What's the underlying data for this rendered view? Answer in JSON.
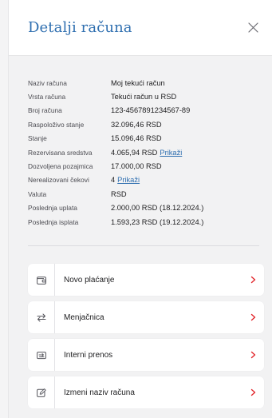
{
  "header": {
    "title": "Detalji računa"
  },
  "details": [
    {
      "label": "Naziv računa",
      "value": "Moj tekući račun",
      "link": ""
    },
    {
      "label": "Vrsta računa",
      "value": "Tekući račun u RSD",
      "link": ""
    },
    {
      "label": "Broj računa",
      "value": "123-4567891234567-89",
      "link": ""
    },
    {
      "label": "Raspoloživo stanje",
      "value": "32.096,46 RSD",
      "link": ""
    },
    {
      "label": "Stanje",
      "value": "15.096,46 RSD",
      "link": ""
    },
    {
      "label": "Rezervisana sredstva",
      "value": "4.065,94 RSD",
      "link": "Prikaži"
    },
    {
      "label": "Dozvoljena pozajmica",
      "value": "17.000,00 RSD",
      "link": ""
    },
    {
      "label": "Nerealizovani čekovi",
      "value": "4",
      "link": "Prikaži"
    },
    {
      "label": "Valuta",
      "value": "RSD",
      "link": ""
    },
    {
      "label": "Poslednja uplata",
      "value": "2.000,00 RSD (18.12.2024.)",
      "link": ""
    },
    {
      "label": "Poslednja isplata",
      "value": "1.593,23 RSD (19.12.2024.)",
      "link": ""
    }
  ],
  "actions": [
    {
      "label": "Novo plaćanje",
      "icon": "wallet-icon"
    },
    {
      "label": "Menjačnica",
      "icon": "exchange-arrows-icon"
    },
    {
      "label": "Interni prenos",
      "icon": "transfer-card-icon"
    },
    {
      "label": "Izmeni naziv računa",
      "icon": "edit-pencil-icon"
    }
  ],
  "colors": {
    "accent": "#2f6fb0",
    "chevron": "#e2262c",
    "background": "#f2f2f3"
  }
}
